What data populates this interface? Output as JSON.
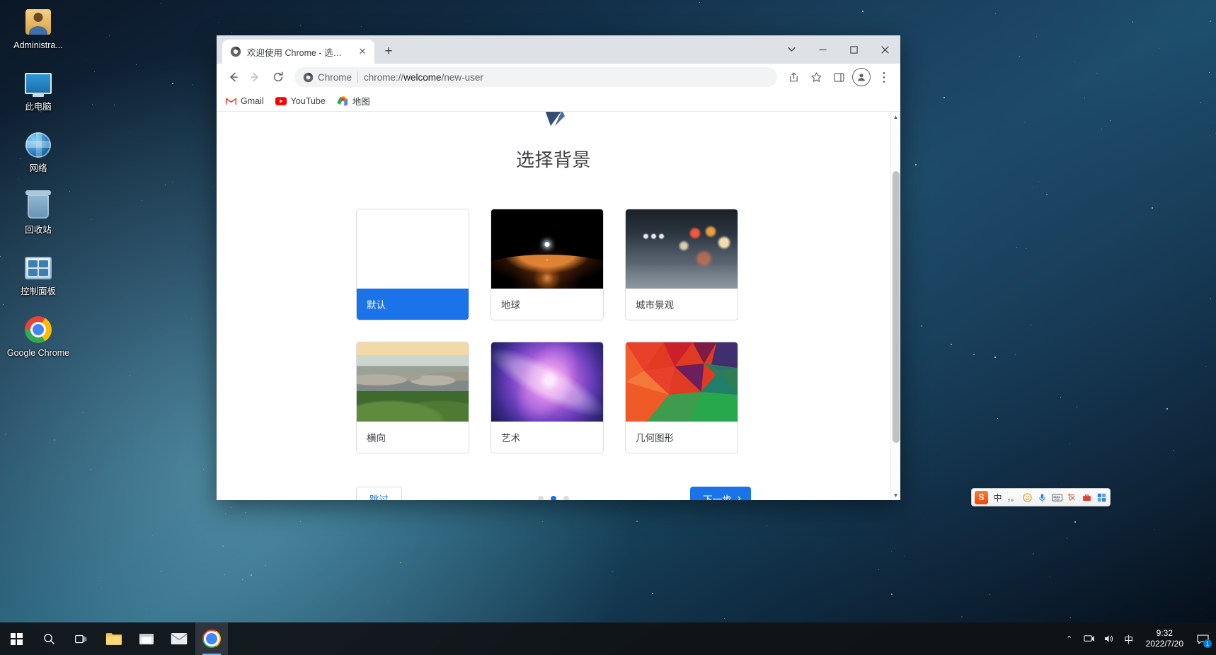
{
  "desktop": {
    "icons": [
      {
        "label": "Administra...",
        "icon": "user-account-icon"
      },
      {
        "label": "此电脑",
        "icon": "this-pc-icon"
      },
      {
        "label": "网络",
        "icon": "network-icon"
      },
      {
        "label": "回收站",
        "icon": "recycle-bin-icon"
      },
      {
        "label": "控制面板",
        "icon": "control-panel-icon"
      },
      {
        "label": "Google Chrome",
        "icon": "chrome-icon"
      }
    ]
  },
  "browser": {
    "tab": {
      "title": "欢迎使用 Chrome - 选择背景",
      "favicon": "chrome-favicon",
      "close_label": "✕"
    },
    "new_tab_label": "+",
    "window_controls": {
      "tab_search": "⌄",
      "minimize": "−",
      "maximize": "☐",
      "close": "✕"
    },
    "toolbar": {
      "back": "←",
      "forward": "→",
      "reload": "⟳",
      "share": "share-icon",
      "bookmark": "star-icon",
      "side_panel": "side-panel-icon",
      "profile": "profile-icon",
      "menu": "⋮"
    },
    "omnibox": {
      "chip_label": "Chrome",
      "url_prefix": "chrome://",
      "url_bold": "welcome",
      "url_suffix": "/new-user",
      "full_url": "chrome://welcome/new-user"
    },
    "bookmarks": [
      {
        "label": "Gmail",
        "icon": "gmail-icon"
      },
      {
        "label": "YouTube",
        "icon": "youtube-icon"
      },
      {
        "label": "地图",
        "icon": "maps-icon"
      }
    ]
  },
  "welcome_page": {
    "title": "选择背景",
    "cards": [
      {
        "label": "默认",
        "thumb": "th-default",
        "selected": true
      },
      {
        "label": "地球",
        "thumb": "th-earth",
        "selected": false
      },
      {
        "label": "城市景观",
        "thumb": "th-city",
        "selected": false
      },
      {
        "label": "横向",
        "thumb": "th-landscape",
        "selected": false
      },
      {
        "label": "艺术",
        "thumb": "th-art",
        "selected": false
      },
      {
        "label": "几何图形",
        "thumb": "th-geo",
        "selected": false
      }
    ],
    "footer": {
      "skip_label": "跳过",
      "next_label": "下一步",
      "next_arrow": "›",
      "step_count": 3,
      "active_step": 2
    },
    "accent_color": "#1a73e8"
  },
  "ime": {
    "logo": "S",
    "items": [
      "中",
      "，。",
      "☺",
      "🎤",
      "⌨",
      "✂",
      "🗑",
      "⊞"
    ]
  },
  "taskbar": {
    "start": "start-icon",
    "search": "search-icon",
    "task_view": "task-view-icon",
    "apps": [
      {
        "name": "file-explorer",
        "active": false
      },
      {
        "name": "microsoft-store",
        "active": false
      },
      {
        "name": "mail",
        "active": false
      },
      {
        "name": "google-chrome",
        "active": true
      }
    ],
    "tray": {
      "overflow": "⌃",
      "network": "network-tray-icon",
      "volume": "volume-icon",
      "ime_lang": "中",
      "time": "9:32",
      "date": "2022/7/20",
      "notification_count": "1"
    }
  }
}
